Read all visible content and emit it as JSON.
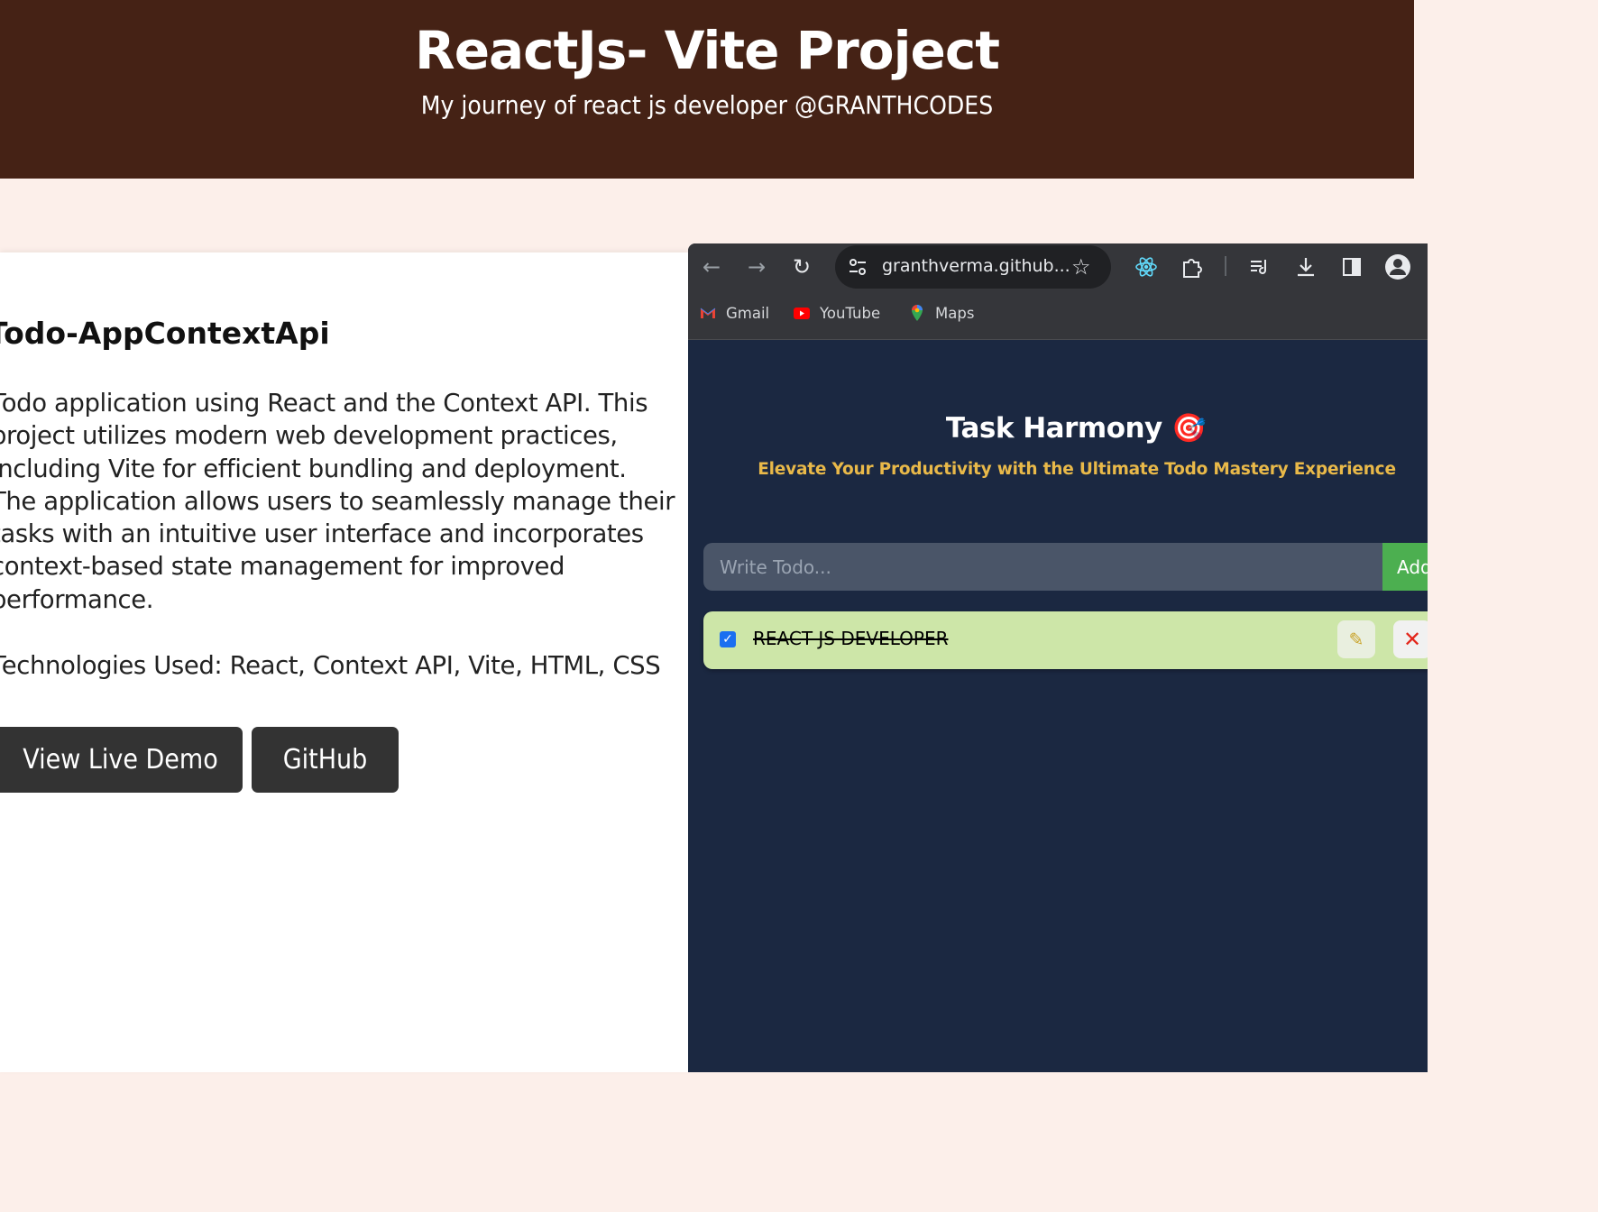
{
  "header": {
    "title": "ReactJs- Vite Project",
    "subtitle": "My journey of react js developer @GRANTHCODES"
  },
  "project": {
    "title": "Todo-AppContextApi",
    "description": "Todo application using React and the Context API. This project utilizes modern web development practices, including Vite for efficient bundling and deployment. The application allows users to seamlessly manage their tasks with an intuitive user interface and incorporates context-based state management for improved performance.",
    "technologies": "Technologies Used: React, Context API, Vite, HTML, CSS",
    "buttons": {
      "demo": "View Live Demo",
      "github": "GitHub"
    }
  },
  "browser": {
    "address": "granthverma.github...",
    "bookmarks": [
      {
        "label": "Gmail",
        "icon": "gmail-icon"
      },
      {
        "label": "YouTube",
        "icon": "youtube-icon"
      },
      {
        "label": "Maps",
        "icon": "maps-icon"
      }
    ],
    "toolbar_icons": [
      "back-arrow-icon",
      "forward-arrow-icon",
      "reload-icon",
      "site-settings-icon",
      "star-icon",
      "react-devtools-icon",
      "extensions-icon",
      "media-icon",
      "download-icon",
      "side-panel-icon",
      "profile-icon"
    ]
  },
  "app": {
    "title": "Task Harmony 🎯",
    "subtitle": "Elevate Your Productivity with the Ultimate Todo Mastery Experience",
    "input_placeholder": "Write Todo...",
    "add_label": "Add",
    "todos": [
      {
        "text": "REACT JS DEVELOPER",
        "completed": true
      }
    ]
  },
  "colors": {
    "header_bg": "#452215",
    "page_bg": "#fcefea",
    "button_bg": "#333333",
    "app_bg": "#1b2841",
    "app_accent": "#e9b949",
    "add_button": "#4caf50",
    "todo_done_bg": "#cde6a8"
  }
}
